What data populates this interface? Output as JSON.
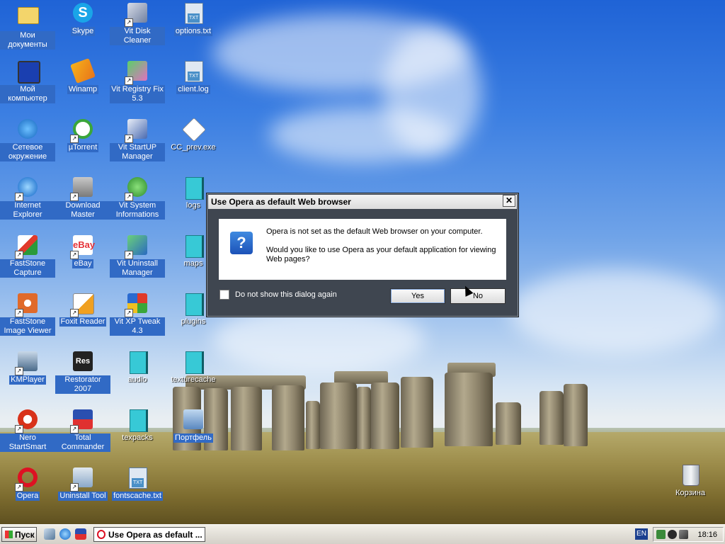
{
  "desktop": {
    "icons": [
      {
        "label": "Мои документы"
      },
      {
        "label": "Мой компьютер"
      },
      {
        "label": "Сетевое окружение"
      },
      {
        "label": "Internet Explorer"
      },
      {
        "label": "FastStone Capture"
      },
      {
        "label": "FastStone Image Viewer"
      },
      {
        "label": "KMPlayer"
      },
      {
        "label": "Nero StartSmart"
      },
      {
        "label": "Opera"
      },
      {
        "label": "Skype"
      },
      {
        "label": "Winamp"
      },
      {
        "label": "µTorrent"
      },
      {
        "label": "Download Master"
      },
      {
        "label": "eBay"
      },
      {
        "label": "Foxit Reader"
      },
      {
        "label": "Restorator 2007"
      },
      {
        "label": "Total Commander"
      },
      {
        "label": "Uninstall Tool"
      },
      {
        "label": "Vit Disk Cleaner"
      },
      {
        "label": "Vit Registry Fix 5.3"
      },
      {
        "label": "Vit StartUP Manager"
      },
      {
        "label": "Vit System Informations"
      },
      {
        "label": "Vit Uninstall Manager"
      },
      {
        "label": "Vit XP Tweak 4.3"
      },
      {
        "label": "audio"
      },
      {
        "label": "texpacks"
      },
      {
        "label": "fontscache.txt"
      },
      {
        "label": "options.txt"
      },
      {
        "label": "client.log"
      },
      {
        "label": "CC_prev.exe"
      },
      {
        "label": "logs"
      },
      {
        "label": "maps"
      },
      {
        "label": "plugins"
      },
      {
        "label": "texturecache"
      },
      {
        "label": "Портфель"
      },
      {
        "label": "Корзина"
      }
    ],
    "txt_badge": "TXT"
  },
  "dialog": {
    "title": "Use Opera as default Web browser",
    "close_glyph": "✕",
    "icon_glyph": "?",
    "message_line1": "Opera is not set as the default Web browser on your computer.",
    "message_line2": "Would you like to use Opera as your default application for viewing Web pages?",
    "checkbox_label": "Do not show this dialog again",
    "checkbox_checked": false,
    "yes_label": "Yes",
    "no_label": "No"
  },
  "taskbar": {
    "start_label": "Пуск",
    "task_button_label": "Use Opera as default ...",
    "language": "EN",
    "clock": "18:16"
  },
  "colors": {
    "selection": "#316ac5",
    "opera_red": "#dd1122"
  }
}
